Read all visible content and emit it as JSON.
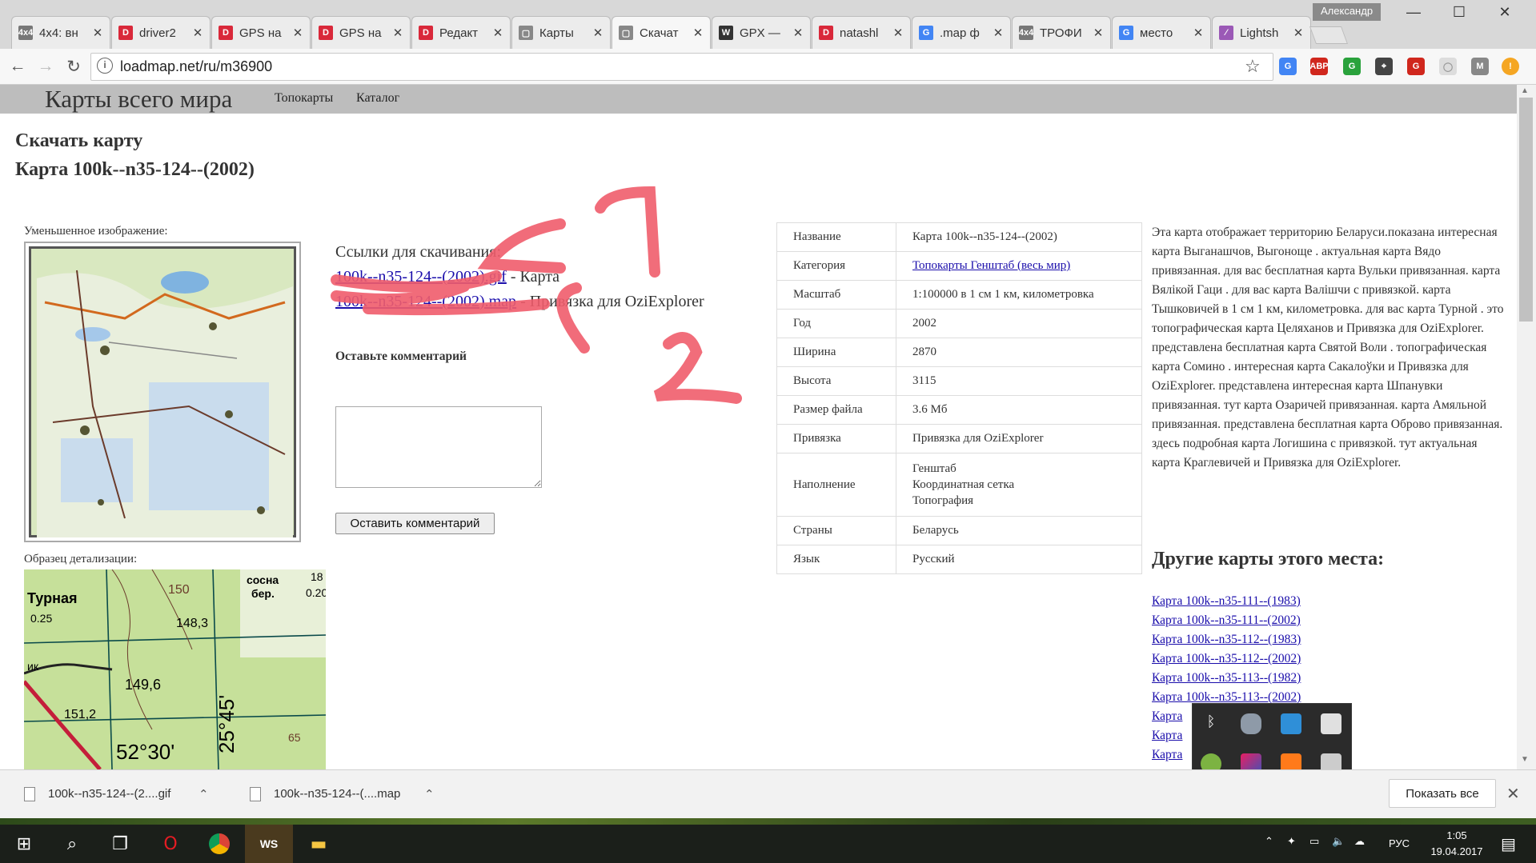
{
  "browser": {
    "user": "Александр",
    "tabs": [
      {
        "label": "4x4: вн",
        "color": "#777777",
        "glyph": "4x4",
        "active": false
      },
      {
        "label": "driver2",
        "color": "#d9283a",
        "glyph": "D",
        "active": false
      },
      {
        "label": "GPS на",
        "color": "#d9283a",
        "glyph": "D",
        "active": false
      },
      {
        "label": "GPS на",
        "color": "#d9283a",
        "glyph": "D",
        "active": false
      },
      {
        "label": "Редакт",
        "color": "#d9283a",
        "glyph": "D",
        "active": false
      },
      {
        "label": "Карты",
        "color": "#888888",
        "glyph": "▢",
        "active": false
      },
      {
        "label": "Скачат",
        "color": "#888888",
        "glyph": "▢",
        "active": true
      },
      {
        "label": "GPX —",
        "color": "#333333",
        "glyph": "W",
        "active": false
      },
      {
        "label": "natashl",
        "color": "#d9283a",
        "glyph": "D",
        "active": false
      },
      {
        "label": ".map ф",
        "color": "#4285f4",
        "glyph": "G",
        "active": false
      },
      {
        "label": "ТРОФИ",
        "color": "#777777",
        "glyph": "4x4",
        "active": false
      },
      {
        "label": "место",
        "color": "#4285f4",
        "glyph": "G",
        "active": false
      },
      {
        "label": "Lightsh",
        "color": "#9b59b6",
        "glyph": "⁄",
        "active": false
      }
    ],
    "url": "loadmap.net/ru/m36900"
  },
  "site": {
    "title": "Карты всего мира",
    "nav": [
      "Топокарты",
      "Каталог"
    ]
  },
  "page": {
    "heading1": "Скачать карту",
    "heading2": "Карта 100k--n35-124--(2002)",
    "thumb_label": "Уменьшенное изображение:",
    "detail_label": "Образец детализации:",
    "links_label": "Ссылки для скачивания:",
    "gif_link": "100k--n35-124--(2002).gif",
    "gif_suffix": " - Карта",
    "map_link": "100k--n35-124--(2002).map",
    "map_suffix": " - Привязка для OziExplorer",
    "comment_label": "Оставьте комментарий",
    "comment_button": "Оставить комментарий",
    "annotation_1": "1",
    "annotation_2": "2",
    "detail_map_texts": [
      "Турная",
      "0.25",
      "сосна",
      "бер.",
      "18",
      "0.20",
      "150",
      "148,3",
      "149,6",
      "151,2",
      "52°30'",
      "25°45'",
      "65",
      "ик"
    ]
  },
  "info": {
    "rows": [
      {
        "k": "Название",
        "v": "Карта 100k--n35-124--(2002)"
      },
      {
        "k": "Категория",
        "v": "Топокарты Генштаб (весь мир)",
        "link": true
      },
      {
        "k": "Масштаб",
        "v": "1:100000 в 1 см 1 км, километровка"
      },
      {
        "k": "Год",
        "v": "2002"
      },
      {
        "k": "Ширина",
        "v": "2870"
      },
      {
        "k": "Высота",
        "v": "3115"
      },
      {
        "k": "Размер файла",
        "v": "3.6 Мб"
      },
      {
        "k": "Привязка",
        "v": "Привязка для OziExplorer"
      },
      {
        "k": "Наполнение",
        "v": [
          "Генштаб",
          "Координатная сетка",
          "Топография"
        ]
      },
      {
        "k": "Страны",
        "v": "Беларусь"
      },
      {
        "k": "Язык",
        "v": "Русский"
      }
    ]
  },
  "description": "Эта карта отображает территорию Беларуси.показана интересная карта Выганашчов, Выгоноще . актуальная карта Вядо привязанная. для вас бесплатная карта Вульки привязанная. карта Вялікой Гаци . для вас карта Валішчи с привязкой. карта Тышковичей в 1 см 1 км, километровка. для вас карта Турной . это топографическая карта Целяханов и Привязка для OziExplorer. представлена бесплатная карта Святой Воли . топографическая карта Сомино . интересная карта Сакалоўки и Привязка для OziExplorer. представлена интересная карта Шпанувки привязанная. тут карта Озаричей привязанная. карта Амяльной привязанная. представлена бесплатная карта Оброво привязанная. здесь подробная карта Логишина с привязкой. тут актуальная карта Краглевичей и Привязка для OziExplorer.",
  "other_maps": {
    "title": "Другие карты этого места:",
    "items": [
      "Карта 100k--n35-111--(1983)",
      "Карта 100k--n35-111--(2002)",
      "Карта 100k--n35-112--(1983)",
      "Карта 100k--n35-112--(2002)",
      "Карта 100k--n35-113--(1982)",
      "Карта 100k--n35-113--(2002)",
      "Карта",
      "Карта",
      "Карта"
    ]
  },
  "downloads": {
    "items": [
      "100k--n35-124--(2....gif",
      "100k--n35-124--(....map"
    ],
    "show_all": "Показать все"
  },
  "taskbar": {
    "lang": "РУС",
    "time": "1:05",
    "date": "19.04.2017"
  },
  "colors": {
    "annotation": "#f05d6c",
    "link": "#1a0dab"
  }
}
